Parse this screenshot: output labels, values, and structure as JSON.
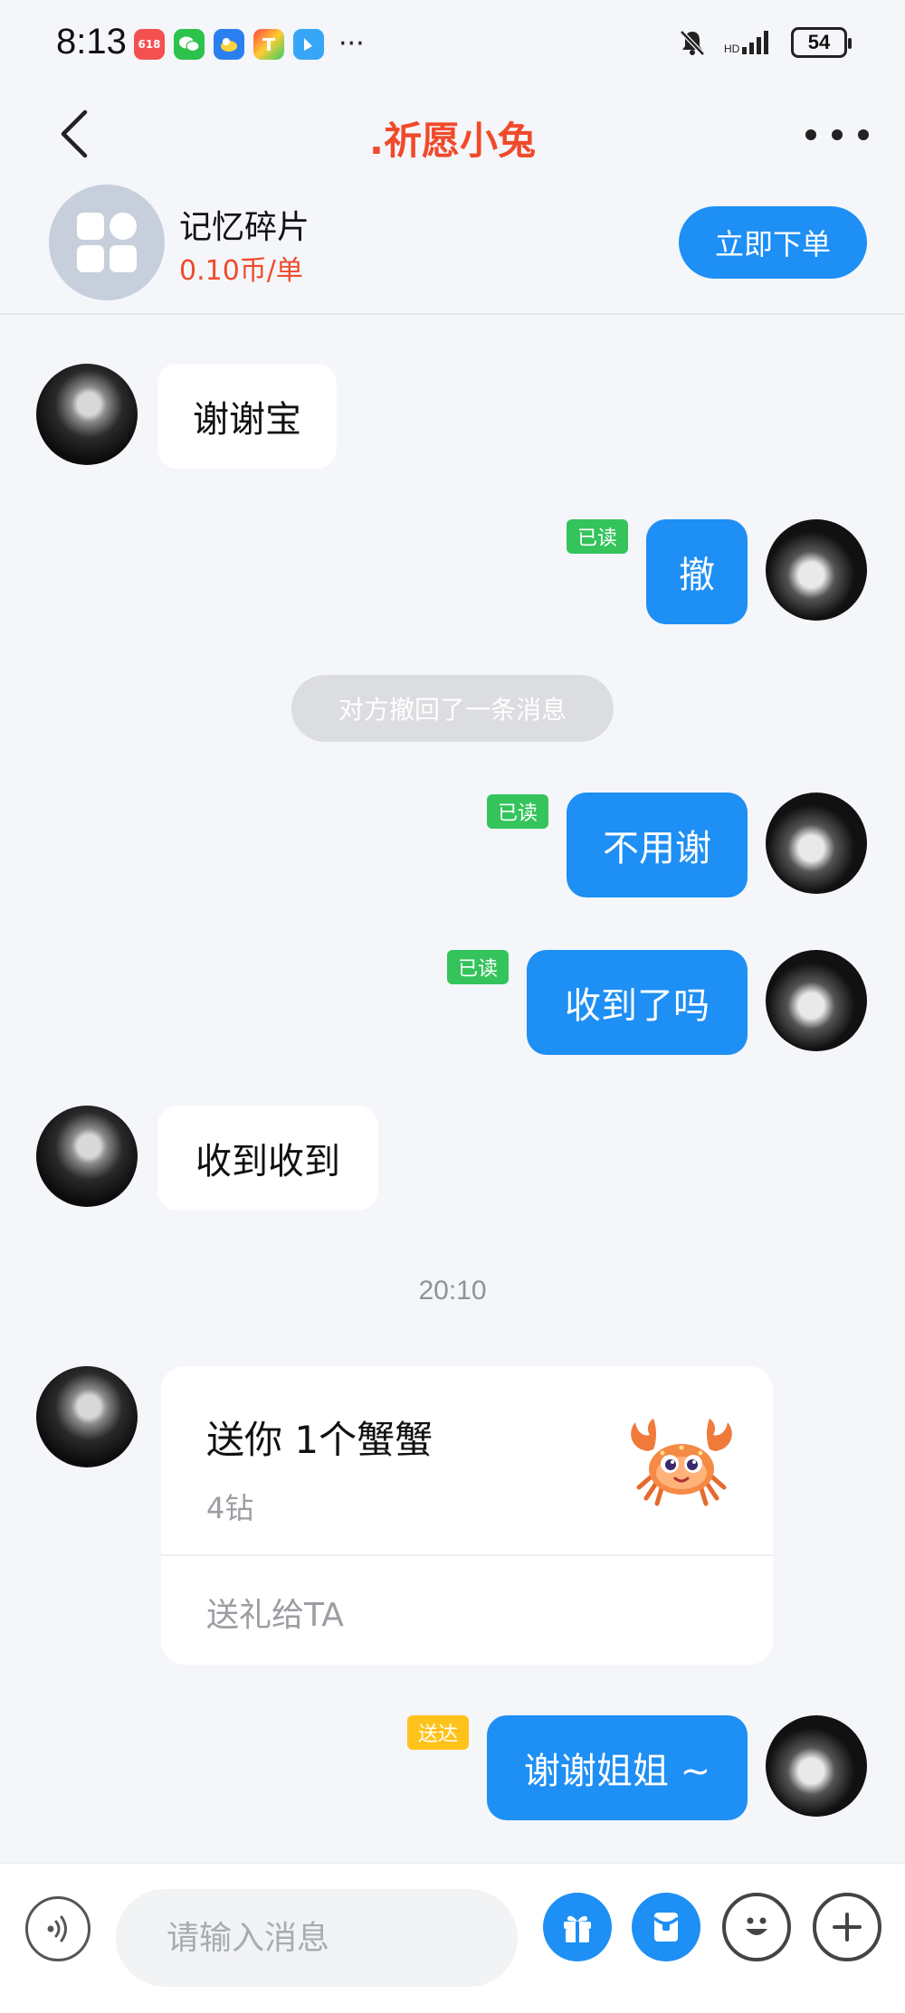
{
  "status_bar": {
    "time": "8:13",
    "apps": [
      {
        "name": "app-icon-1",
        "label": "618",
        "color": "#f4504f"
      },
      {
        "name": "wechat-icon",
        "label": "",
        "color": "#2cc24c"
      },
      {
        "name": "app-icon-3",
        "label": "",
        "color": "#2a80f0"
      },
      {
        "name": "app-icon-4",
        "label": "",
        "color": "#f77a3c"
      },
      {
        "name": "app-icon-5",
        "label": "",
        "color": "#37a6f7"
      }
    ],
    "more": "···",
    "battery": "54"
  },
  "nav": {
    "title": ".祈愿小兔"
  },
  "product": {
    "name": "记忆碎片",
    "price": "0.10币/单",
    "order_button": "立即下单"
  },
  "messages": {
    "m1": {
      "text": "谢谢宝"
    },
    "m2": {
      "text": "撤",
      "status": "已读"
    },
    "system": "对方撤回了一条消息",
    "m3": {
      "text": "不用谢",
      "status": "已读"
    },
    "m4": {
      "text": "收到了吗",
      "status": "已读"
    },
    "m5": {
      "text": "收到收到"
    },
    "timestamp": "20:10",
    "gift": {
      "title": "送你 1个蟹蟹",
      "price": "4钻",
      "action": "送礼给TA"
    },
    "m6": {
      "text": "谢谢姐姐 ~",
      "status": "送达"
    }
  },
  "input": {
    "placeholder": "请输入消息"
  },
  "colors": {
    "accent": "#1e8ff4",
    "title_red": "#f04a2b",
    "read_green": "#34c45b",
    "delivered_yellow": "#ffc21a"
  }
}
